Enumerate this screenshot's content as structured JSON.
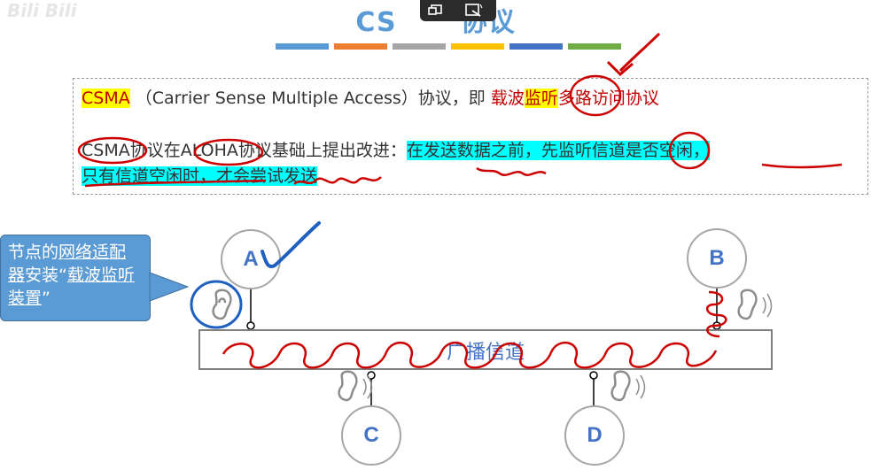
{
  "watermark": "Bili Bili",
  "title": {
    "prefix": "CS",
    "suffix": "协议"
  },
  "toolbar": {
    "icons": [
      "window-icon",
      "magic-wand-icon"
    ]
  },
  "color_bars": [
    "#5b9bd5",
    "#ed7d31",
    "#a5a5a5",
    "#ffc000",
    "#4472c4",
    "#70ad47"
  ],
  "definition": {
    "csma": "CSMA",
    "expansion": "（Carrier Sense Multiple Access）协议，即",
    "name_part1": "载波",
    "name_highlight": "监听",
    "name_part2": "多路访问协议"
  },
  "improvement": {
    "intro": "CSMA协议在ALOHA协议基础上提出改进：",
    "highlight1": "在发送数据之前，先监听信道是否空闲，",
    "highlight2": "只有信道空闲时，才会尝试发送"
  },
  "callout": {
    "part1": "节点的",
    "part2": "网络适配器",
    "part3": "安装“",
    "part4": "载波监听装置",
    "part5": "”"
  },
  "channel": {
    "label": "广播信道"
  },
  "nodes": {
    "a": "A",
    "b": "B",
    "c": "C",
    "d": "D"
  },
  "colors": {
    "title": "#5b9bd5",
    "node_text": "#4472c4",
    "annotation": "#cc0000",
    "highlight_cyan": "#00ffff",
    "highlight_yellow": "#ffff00"
  }
}
